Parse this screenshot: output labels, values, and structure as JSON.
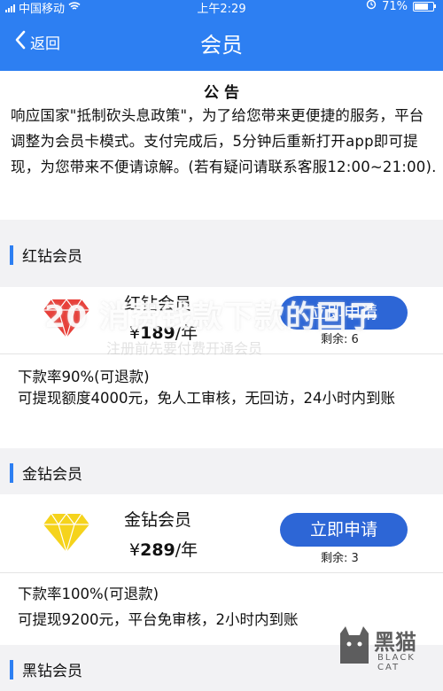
{
  "status_bar": {
    "carrier": "中国移动",
    "time": "上午2:29",
    "battery": "71%"
  },
  "nav": {
    "back_label": "返回",
    "title": "会员"
  },
  "notice": {
    "title": "公 告",
    "body": "响应国家\"抵制砍头息政策\"，为了给您带来更便捷的服务，平台调整为会员卡模式。支付完成后，5分钟后重新打开app即可提现，为您带来不便请谅解。(若有疑问请联系客服12:00~21:00)."
  },
  "tiers": [
    {
      "section_label": "红钻会员",
      "name": "红钻会员",
      "price_prefix": "¥",
      "price_amount": "189",
      "price_unit": "/年",
      "button_label": "立即申请",
      "remain_label": "剩余:",
      "remain_count": "6",
      "rate_text": "下款率90%(可退款)",
      "detail_text": "可提现额度4000元，免人工审核，无回访，24小时内到账",
      "gem_color": "#e8403a"
    },
    {
      "section_label": "金钻会员",
      "name": "金钻会员",
      "price_prefix": "¥",
      "price_amount": "289",
      "price_unit": "/年",
      "button_label": "立即申请",
      "remain_label": "剩余:",
      "remain_count": "3",
      "rate_text": "下款率100%(可退款)",
      "detail_text": "可提现9200元，平台免审核，2小时内到账",
      "gem_color": "#f5d31c"
    },
    {
      "section_label": "黑钻会员"
    }
  ],
  "watermark": {
    "text": "20  消费钱款下款的回子",
    "sub_text": "注册前先要付费开通会员"
  },
  "logo": {
    "text": "黑猫",
    "sub_text": "BLACK CAT"
  },
  "colors": {
    "primary": "#2d7ff2",
    "button": "#2d66d6",
    "red_gem": "#e8403a",
    "gold_gem": "#f5d31c"
  }
}
